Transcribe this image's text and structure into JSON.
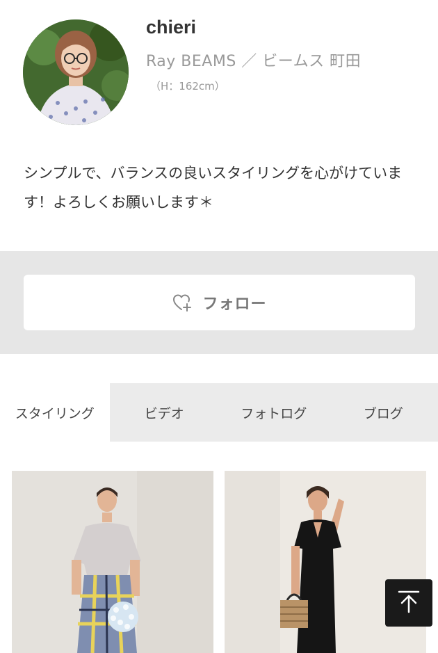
{
  "profile": {
    "name": "chieri",
    "shop": "Ray BEAMS ／ ビームス 町田",
    "height": "（H：162cm）",
    "bio": "シンプルで、バランスの良いスタイリングを心がけています！よろしくお願いします＊"
  },
  "follow": {
    "label": "フォロー",
    "icon": "heart-plus-icon"
  },
  "tabs": [
    {
      "label": "スタイリング",
      "active": true
    },
    {
      "label": "ビデオ",
      "active": false
    },
    {
      "label": "フォトログ",
      "active": false
    },
    {
      "label": "ブログ",
      "active": false
    }
  ],
  "back_to_top": {
    "icon": "arrow-up-to-top-icon"
  },
  "colors": {
    "band": "#e6e6e6",
    "tab_bar": "#ebebeb",
    "text_muted": "#999999",
    "back_to_top_bg": "#1a1a1a"
  }
}
